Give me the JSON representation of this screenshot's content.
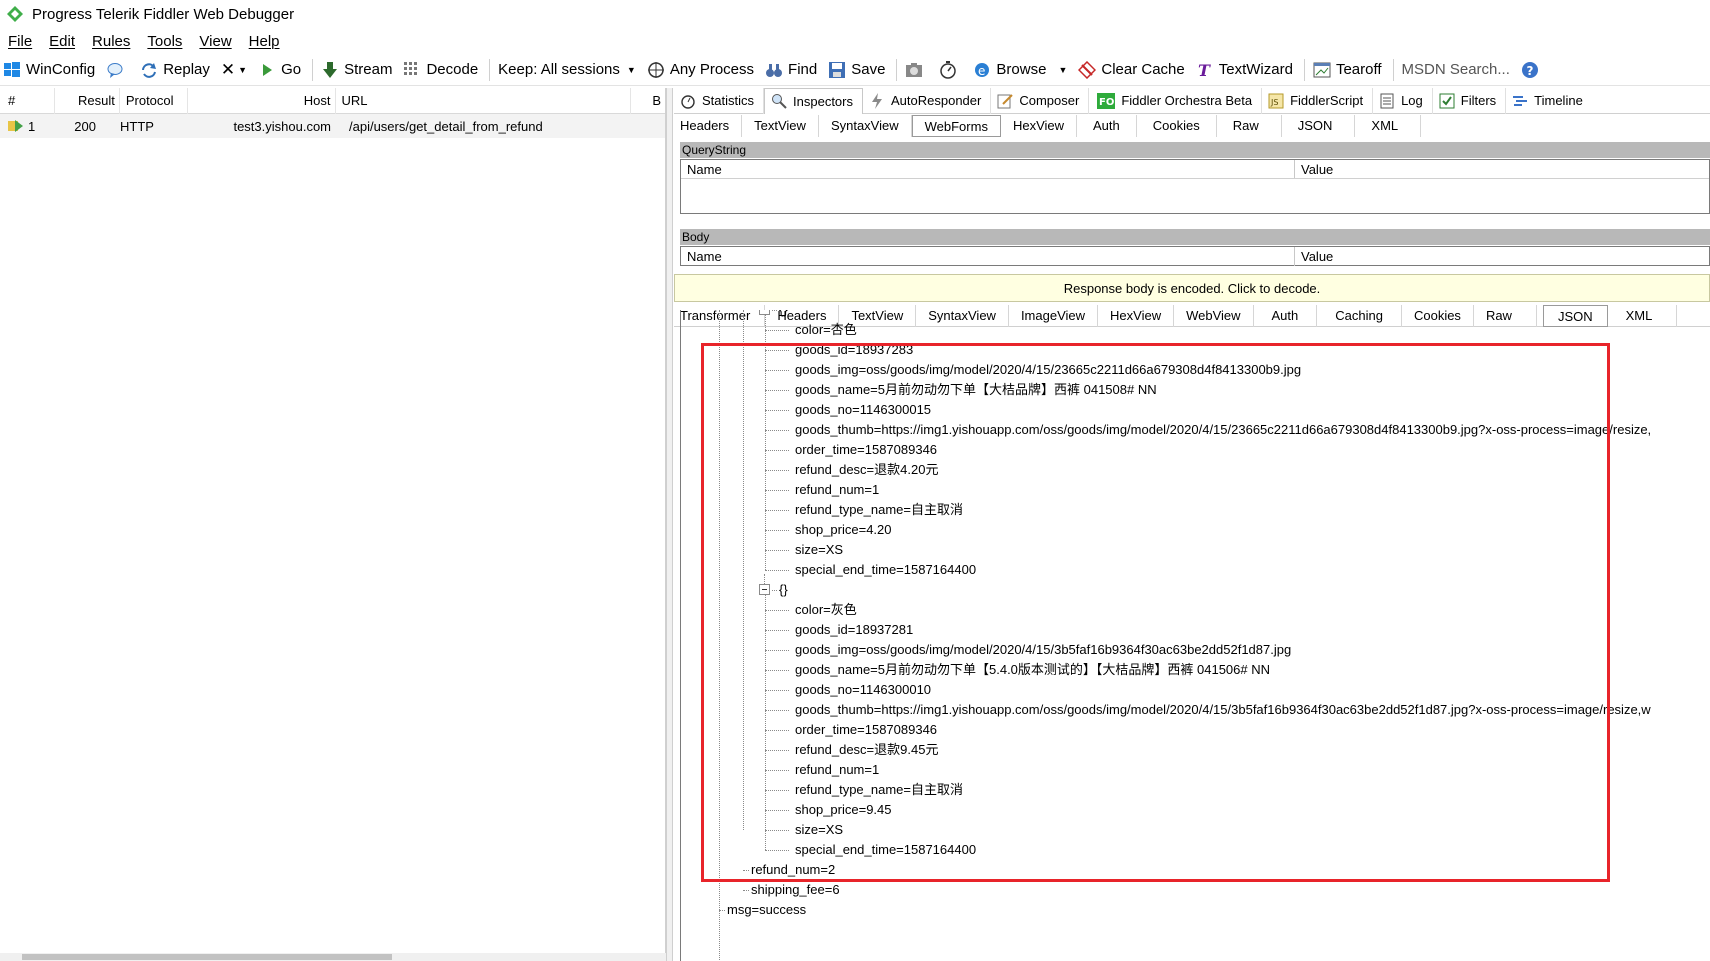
{
  "window": {
    "title": "Progress Telerik Fiddler Web Debugger",
    "logo_icon": "fiddler-diamond-icon",
    "accent": "#4caf50"
  },
  "menu": [
    "File",
    "Edit",
    "Rules",
    "Tools",
    "View",
    "Help"
  ],
  "toolbar": {
    "winconfig": "WinConfig",
    "replay": "Replay",
    "remove": "✕",
    "go": "Go",
    "stream": "Stream",
    "decode": "Decode",
    "keep": "Keep: All sessions",
    "any_process": "Any Process",
    "find": "Find",
    "save": "Save",
    "browse": "Browse",
    "clear_cache": "Clear Cache",
    "textwizard": "TextWizard",
    "tearoff": "Tearoff",
    "msdn_search": "MSDN Search..."
  },
  "sessions": {
    "columns": [
      "#",
      "Result",
      "Protocol",
      "Host",
      "URL",
      "B"
    ],
    "rows": [
      {
        "num": "1",
        "result": "200",
        "protocol": "HTTP",
        "host": "test3.yishou.com",
        "url": "/api/users/get_detail_from_refund"
      }
    ]
  },
  "inspector_tabs": [
    "Statistics",
    "Inspectors",
    "AutoResponder",
    "Composer",
    "Fiddler Orchestra Beta",
    "FiddlerScript",
    "Log",
    "Filters",
    "Timeline"
  ],
  "request_tabs": [
    "Headers",
    "TextView",
    "SyntaxView",
    "WebForms",
    "HexView",
    "Auth",
    "Cookies",
    "Raw",
    "JSON",
    "XML"
  ],
  "request_active": "WebForms",
  "querystring": {
    "title": "QueryString",
    "name_col": "Name",
    "value_col": "Value"
  },
  "body": {
    "title": "Body",
    "name_col": "Name",
    "value_col": "Value"
  },
  "notice": "Response body is encoded. Click to decode.",
  "response_tabs": [
    "Transformer",
    "Headers",
    "TextView",
    "SyntaxView",
    "ImageView",
    "HexView",
    "WebView",
    "Auth",
    "Caching",
    "Cookies",
    "Raw",
    "JSON",
    "XML"
  ],
  "response_active": "JSON",
  "json_tree": {
    "object1": {
      "label": "{}",
      "fields": [
        "color=杏色",
        "goods_id=18937283",
        "goods_img=oss/goods/img/model/2020/4/15/23665c2211d66a679308d4f8413300b9.jpg",
        "goods_name=5月前勿动勿下单【大桔品牌】西裤  041508# NN",
        "goods_no=1146300015",
        "goods_thumb=https://img1.yishouapp.com/oss/goods/img/model/2020/4/15/23665c2211d66a679308d4f8413300b9.jpg?x-oss-process=image/resize,",
        "order_time=1587089346",
        "refund_desc=退款4.20元",
        "refund_num=1",
        "refund_type_name=自主取消",
        "shop_price=4.20",
        "size=XS",
        "special_end_time=1587164400"
      ]
    },
    "object2": {
      "label": "{}",
      "fields": [
        "color=灰色",
        "goods_id=18937281",
        "goods_img=oss/goods/img/model/2020/4/15/3b5faf16b9364f30ac63be2dd52f1d87.jpg",
        "goods_name=5月前勿动勿下单【5.4.0版本测试的】【大桔品牌】西裤  041506# NN",
        "goods_no=1146300010",
        "goods_thumb=https://img1.yishouapp.com/oss/goods/img/model/2020/4/15/3b5faf16b9364f30ac63be2dd52f1d87.jpg?x-oss-process=image/resize,w",
        "order_time=1587089346",
        "refund_desc=退款9.45元",
        "refund_num=1",
        "refund_type_name=自主取消",
        "shop_price=9.45",
        "size=XS",
        "special_end_time=1587164400"
      ]
    },
    "tail": [
      "refund_num=2",
      "shipping_fee=6"
    ],
    "root_tail": "msg=success"
  },
  "highlight_color": "#e8242a"
}
